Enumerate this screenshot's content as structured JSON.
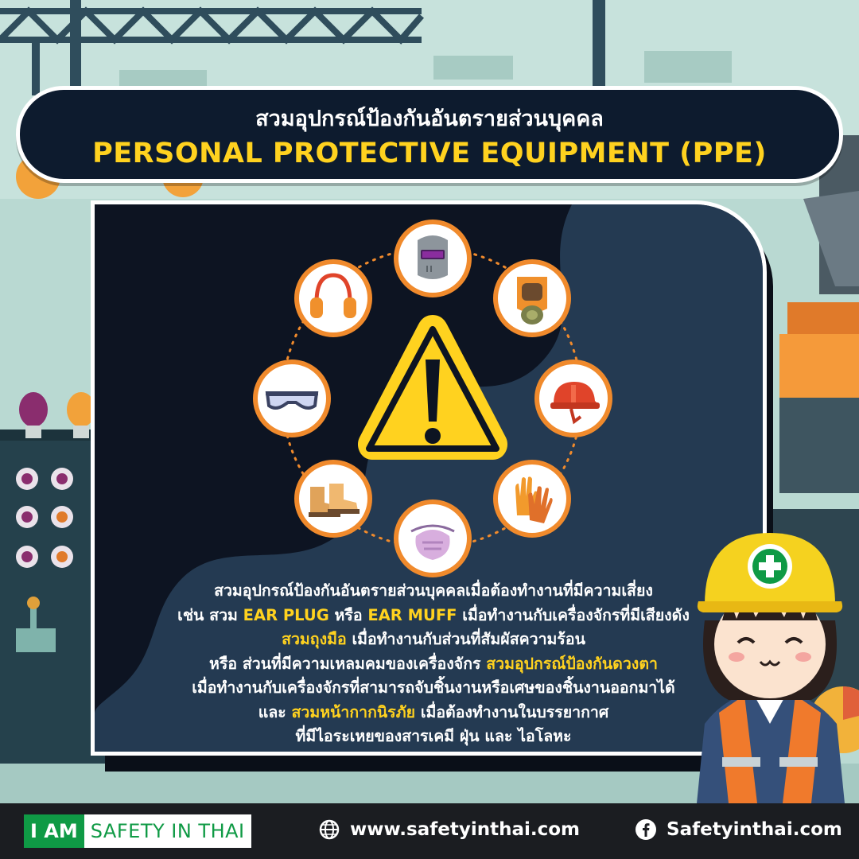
{
  "title": {
    "thai": "สวมอุปกรณ์ป้องกันอันตรายส่วนบุคคล",
    "english": "PERSONAL PROTECTIVE EQUIPMENT (PPE)"
  },
  "ppe_icons": [
    "welding-helmet-icon",
    "gas-mask-icon",
    "hard-hat-icon",
    "safety-gloves-icon",
    "dust-mask-icon",
    "safety-boots-icon",
    "safety-goggles-icon",
    "ear-muff-icon"
  ],
  "body": {
    "line1": "สวมอุปกรณ์ป้องกันอันตรายส่วนบุคคลเมื่อต้องทำงานที่มีความเสี่ยง",
    "line2_a": "เช่น สวม ",
    "line2_hl1": "EAR PLUG",
    "line2_b": " หรือ ",
    "line2_hl2": "EAR MUFF",
    "line2_c": " เมื่อทำงานกับเครื่องจักรที่มีเสียงดัง",
    "line3_hl": "สวมถุงมือ",
    "line3_b": " เมื่อทำงานกับส่วนที่สัมผัสความร้อน",
    "line4_a": "หรือ ส่วนที่มีความเหลมคมของเครื่องจักร ",
    "line4_hl": "สวมอุปกรณ์ป้องกันดวงตา",
    "line5": "เมื่อทำงานกับเครื่องจักรที่สามารถจับชิ้นงานหรือเศษของชิ้นงานออกมาได้",
    "line6_a": "และ ",
    "line6_hl": "สวมหน้ากากนิรภัย",
    "line6_b": " เมื่อต้องทำงานในบรรยากาศ",
    "line7": "ที่มีไอระเหยของสารเคมี ฝุ่น และ ไอโลหะ"
  },
  "footer": {
    "brand_iam": "I AM",
    "brand_rest": "SAFETY IN THAI",
    "website": "www.safetyinthai.com",
    "facebook": "Safetyinthai.com"
  },
  "colors": {
    "banner_bg": "#0d1b2e",
    "accent_yellow": "#ffd21f",
    "brand_green": "#0f9a45",
    "icon_ring": "#f08a2c"
  }
}
